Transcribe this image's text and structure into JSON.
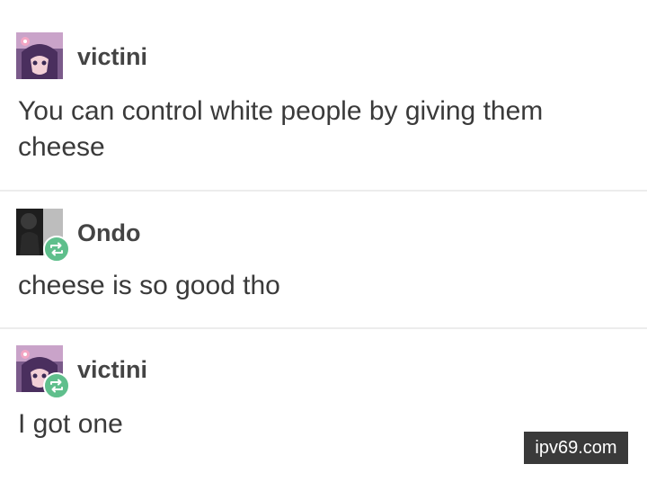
{
  "posts": [
    {
      "username": "victini",
      "text": "You can control white people by giving them cheese",
      "avatar_icon": "anime-character-avatar",
      "reblogged": false
    },
    {
      "username": "Ondo",
      "text": "cheese is so good tho",
      "avatar_icon": "dark-photo-avatar",
      "reblogged": true
    },
    {
      "username": "victini",
      "text": "I got one",
      "avatar_icon": "anime-character-avatar",
      "reblogged": true
    }
  ],
  "reblog_icon": "reblog-arrows-icon",
  "reblog_color": "#5fbf8c",
  "watermark": {
    "text": "ipv69.com"
  }
}
